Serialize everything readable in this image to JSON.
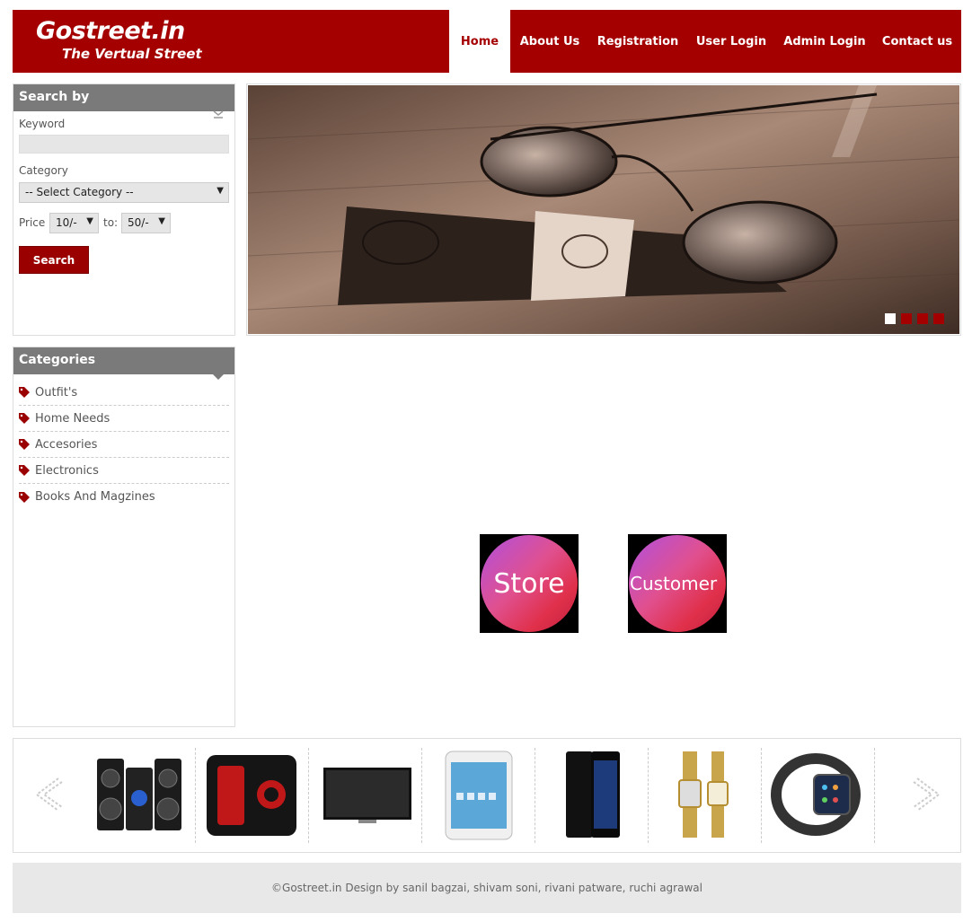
{
  "logo": {
    "name": "Gostreet.in",
    "tagline": "The Vertual Street"
  },
  "nav": {
    "items": [
      {
        "label": "Home",
        "active": true
      },
      {
        "label": "About Us",
        "active": false
      },
      {
        "label": "Registration",
        "active": false
      },
      {
        "label": "User Login",
        "active": false
      },
      {
        "label": "Admin Login",
        "active": false
      },
      {
        "label": "Contact us",
        "active": false
      }
    ]
  },
  "search": {
    "title": "Search by",
    "keyword_label": "Keyword",
    "keyword_value": "",
    "category_label": "Category",
    "category_selected": "-- Select Category --",
    "price_label": "Price",
    "price_from": "10/-",
    "price_to_label": "to:",
    "price_to": "50/-",
    "button_label": "Search"
  },
  "categories": {
    "title": "Categories",
    "items": [
      "Outfit's",
      "Home Needs",
      "Accesories",
      "Electronics",
      "Books And Magzines"
    ]
  },
  "slider": {
    "slide_count": 4,
    "active_slide": 1
  },
  "actions": {
    "store_label": "Store",
    "customer_label": "Customer"
  },
  "carousel": {
    "products": [
      "speaker-system",
      "beats-speaker",
      "tv",
      "tablet",
      "smartphone",
      "watch-pair",
      "smartwatch"
    ]
  },
  "footer": {
    "text": "©Gostreet.in Design by sanil bagzai, shivam soni, rivani patware, ruchi agrawal"
  },
  "colors": {
    "brand": "#a50000",
    "sidebar_head": "#7a7a7a",
    "footer_bg": "#e8e8e8"
  }
}
